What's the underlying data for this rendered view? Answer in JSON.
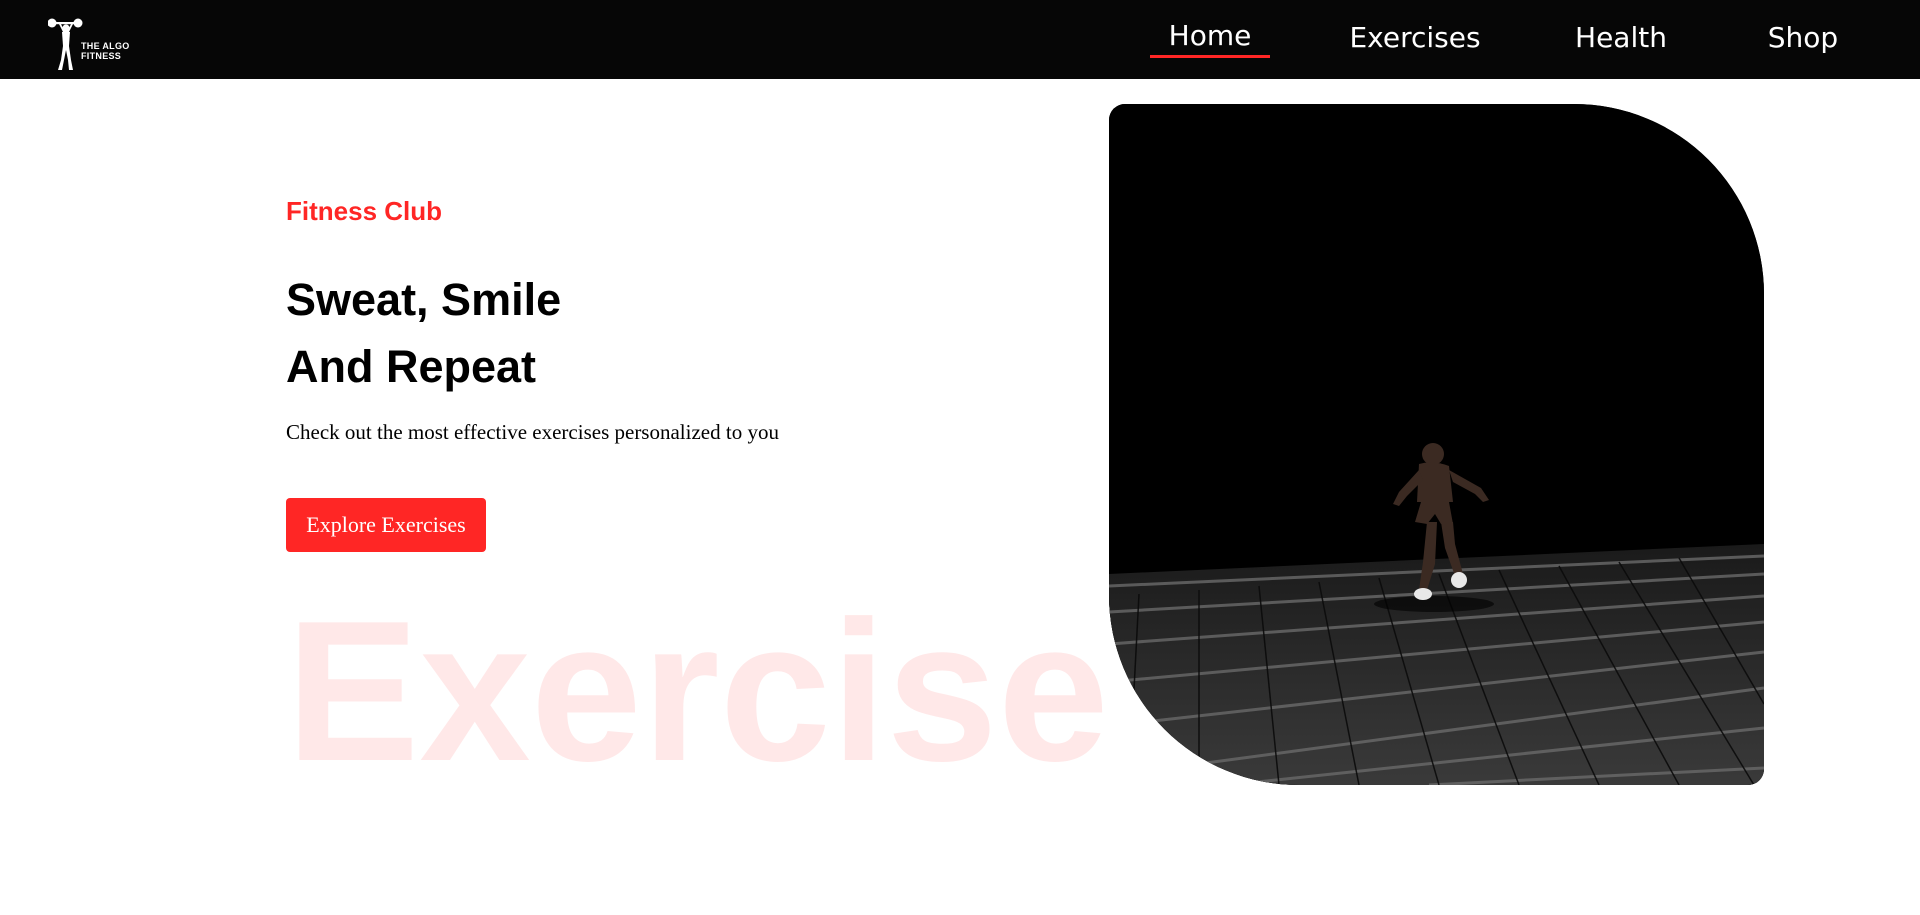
{
  "brand": {
    "logo_line1": "THE ALGO",
    "logo_line2": "FITNESS",
    "accent_color": "#ff2625",
    "nav_background": "#060606"
  },
  "nav": {
    "home": "Home",
    "exercises": "Exercises",
    "health": "Health",
    "shop": "Shop",
    "active": "Home"
  },
  "hero": {
    "eyebrow": "Fitness Club",
    "headline_line1": "Sweat, Smile",
    "headline_line2": "And Repeat",
    "subtext": "Check out the most effective exercises personalized to you",
    "cta_label": "Explore Exercises",
    "watermark": "Exercise"
  },
  "icons": {
    "logo": "weightlifter-logo-icon"
  }
}
